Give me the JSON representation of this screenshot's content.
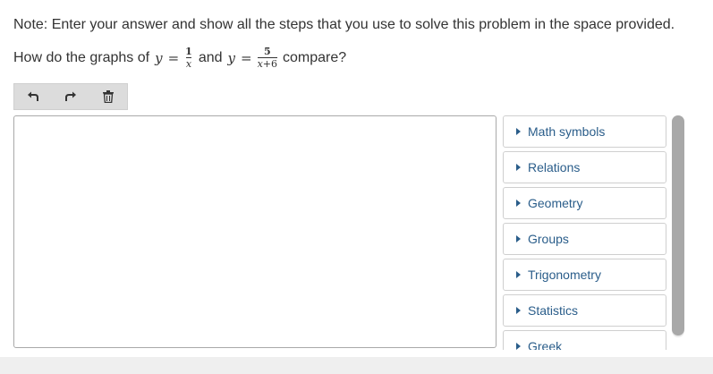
{
  "note": "Note: Enter your answer and show all the steps that you use to solve this problem in the space provided.",
  "question": {
    "prefix": "How do the graphs of",
    "var1": "y",
    "eq1": "=",
    "frac1_num": "1",
    "frac1_den": "x",
    "connector": "and",
    "var2": "y",
    "eq2": "=",
    "frac2_num": "5",
    "frac2_den_var": "x",
    "frac2_den_rest": "+6",
    "suffix": "compare?"
  },
  "toolbar": {
    "undo_icon": "undo-icon",
    "redo_icon": "redo-icon",
    "delete_icon": "trash-icon"
  },
  "palette": {
    "items": [
      {
        "label": "Math symbols"
      },
      {
        "label": "Relations"
      },
      {
        "label": "Geometry"
      },
      {
        "label": "Groups"
      },
      {
        "label": "Trigonometry"
      },
      {
        "label": "Statistics"
      },
      {
        "label": "Greek"
      }
    ]
  },
  "colors": {
    "link": "#2a5d8a",
    "toolbar_bg": "#dcdcdc",
    "scrollbar": "#a8a8a8"
  }
}
